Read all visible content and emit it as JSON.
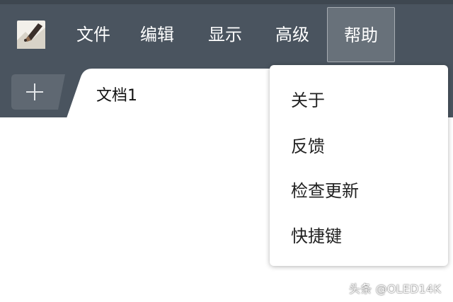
{
  "menubar": {
    "items": [
      {
        "label": "文件"
      },
      {
        "label": "编辑"
      },
      {
        "label": "显示"
      },
      {
        "label": "高级"
      },
      {
        "label": "帮助",
        "active": true
      }
    ]
  },
  "tabs": [
    {
      "label": "文档1",
      "active": true
    }
  ],
  "help_menu": {
    "items": [
      {
        "label": "关于"
      },
      {
        "label": "反馈"
      },
      {
        "label": "检查更新"
      },
      {
        "label": "快捷键"
      }
    ]
  },
  "watermark": {
    "text": "头条 @OLED14K"
  },
  "icons": {
    "app_logo": "pen-nib-logo-icon",
    "new_tab": "plus-icon"
  },
  "colors": {
    "toolbar_bg": "#4a545f",
    "active_menu_bg": "#68717a",
    "tab_bg": "#ffffff"
  }
}
